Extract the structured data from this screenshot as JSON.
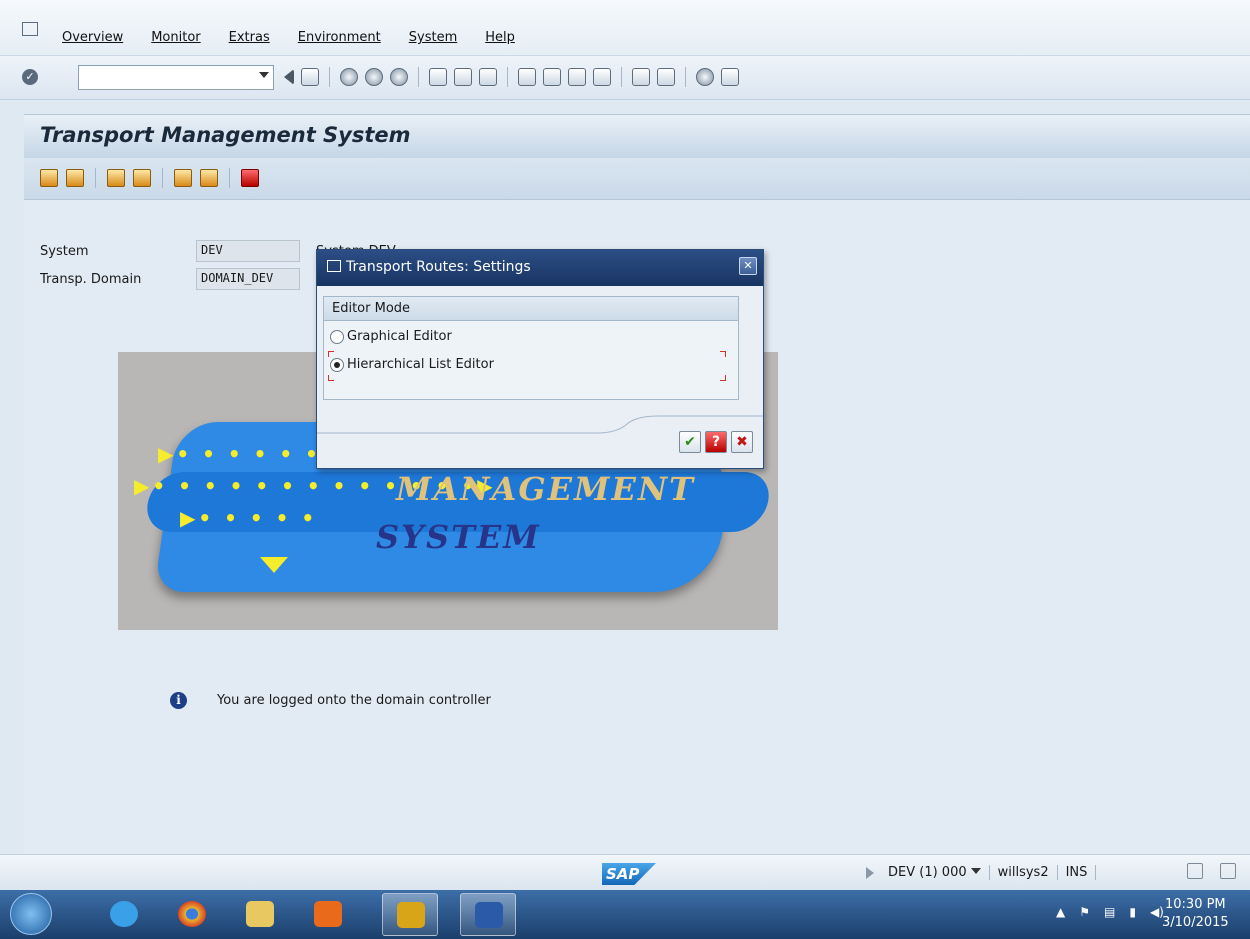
{
  "menu": {
    "items": [
      "Overview",
      "Monitor",
      "Extras",
      "Environment",
      "System",
      "Help"
    ]
  },
  "toolbar": {
    "command_value": ""
  },
  "page": {
    "title": "Transport Management System"
  },
  "fields": {
    "system_label": "System",
    "system_value": "DEV",
    "domain_label": "Transp. Domain",
    "domain_value": "DOMAIN_DEV",
    "behind_text": "System DEV"
  },
  "logo": {
    "word1": "MANAGEMENT",
    "word2": "SYSTEM"
  },
  "message": {
    "text": "You are logged onto the domain controller"
  },
  "dialog": {
    "title": "Transport Routes: Settings",
    "group_title": "Editor Mode",
    "option1": "Graphical Editor",
    "option2": "Hierarchical List Editor",
    "selected": "Hierarchical List Editor"
  },
  "status": {
    "sap_logo": "SAP",
    "system_client": "DEV (1) 000",
    "host": "willsys2",
    "mode": "INS"
  },
  "taskbar": {
    "time": "10:30 PM",
    "date": "3/10/2015"
  },
  "colors": {
    "accent": "#183462",
    "background": "#e2ebf3",
    "logo_blue": "#2f8ae6",
    "logo_yellow": "#f5ec2b"
  }
}
